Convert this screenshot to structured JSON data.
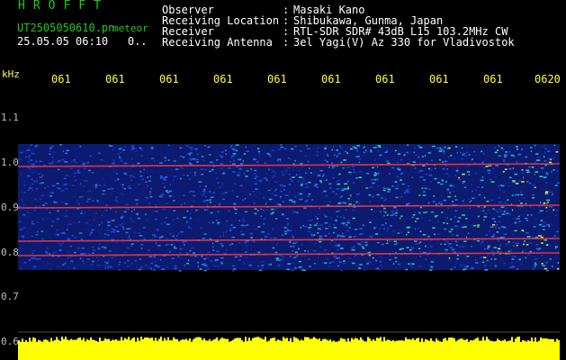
{
  "logo": "HROFFT",
  "file_name": "UT2505050610.pn",
  "meteor_label": "meteor",
  "date_time": "25.05.05 06:10",
  "date_suffix": "0..",
  "header": {
    "observer_key": "Observer",
    "observer_value": "Masaki Kano",
    "location_key": "Receiving Location",
    "location_value": "Shibukawa, Gunma, Japan",
    "receiver_key": "Receiver",
    "receiver_value": "RTL-SDR SDR# 43dB L15 103.2MHz CW",
    "antenna_key": "Receiving Antenna",
    "antenna_value": "3el Yagi(V) Az 330 for Vladivostok",
    "separator": ":"
  },
  "axes": {
    "y_unit": "kHz",
    "y_ticks": [
      "1.1",
      "1.0",
      "0.9",
      "0.8",
      "0.7",
      "0.6"
    ],
    "x_ticks": [
      "061",
      "061",
      "061",
      "061",
      "061",
      "061",
      "061",
      "061",
      "061",
      "0620"
    ]
  },
  "colors": {
    "text_green": "#21c821",
    "text_white": "#ffffff",
    "tick_yellow": "#ffff3c",
    "noise_base": "#1e3cc8",
    "echo_line": "#ff3030",
    "noise_floor": "#ffff00",
    "background": "#000000"
  }
}
